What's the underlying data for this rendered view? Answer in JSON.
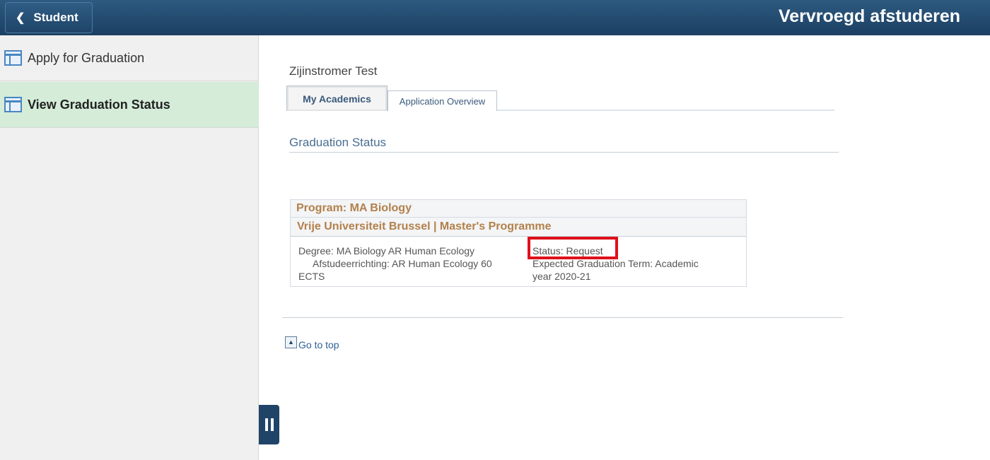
{
  "header": {
    "back_label": "Student",
    "title": "Vervroegd afstuderen"
  },
  "sidebar": {
    "items": [
      {
        "label": "Apply for Graduation",
        "active": false
      },
      {
        "label": "View Graduation Status",
        "active": true
      }
    ]
  },
  "content": {
    "student_name": "Zijinstromer Test",
    "tabs": [
      {
        "label": "My Academics",
        "active": true
      },
      {
        "label": "Application Overview",
        "active": false
      }
    ],
    "section_title": "Graduation Status",
    "program": {
      "program_label": "Program: MA Biology",
      "institution_label": "Vrije Universiteit Brussel | Master's Programme",
      "degree_line1": "Degree: MA Biology AR Human Ecology",
      "degree_line2": "Afstudeerrichting: AR Human Ecology 60",
      "degree_line3": "ECTS",
      "status": "Status: Request",
      "expected_term_line1": "Expected Graduation Term: Academic",
      "expected_term_line2": "year 2020-21"
    },
    "go_to_top": "Go to top"
  },
  "colors": {
    "header_bg": "#1f4468",
    "active_nav_bg": "#d4ecd8",
    "program_text": "#b3804b",
    "highlight_border": "#e0101a"
  },
  "icons": {
    "back": "chevron-left-icon",
    "nav": "page-layout-icon",
    "collapse": "pause-icon",
    "go_top": "arrow-up-icon"
  }
}
